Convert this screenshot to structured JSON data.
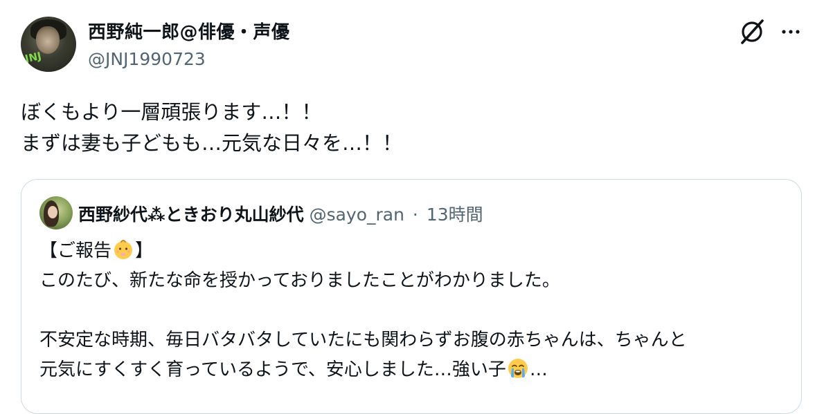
{
  "author": {
    "display_name": "西野純一郎@俳優・声優",
    "handle": "@JNJ1990723",
    "avatar_text": "JNJ"
  },
  "tweet": {
    "lines": [
      "ぼくもより一層頑張ります…！！",
      "まずは妻も子どもも…元気な日々を…！！"
    ]
  },
  "quote": {
    "author_name": "西野紗代⁂ときおり丸山紗代",
    "author_handle": "@sayo_ran",
    "separator": "·",
    "time": "13時間",
    "line1_prefix": "【ご報告",
    "line1_suffix": "】",
    "line2": "このたび、新たな命を授かっておりましたことがわかりました。",
    "line4": "不安定な時期、毎日バタバタしていたにも関わらずお腹の赤ちゃんは、ちゃんと",
    "line5_prefix": "元気にすくすく育っているようで、安心しました…強い子",
    "line5_suffix": "…"
  },
  "icons": {
    "grok": "grok-icon",
    "more": "more-options-icon",
    "baby_emoji": "baby-emoji",
    "crying_emoji": "loudly-crying-face-emoji"
  },
  "colors": {
    "text": "#0f1419",
    "secondary_text": "#536471",
    "border": "#cfd9de",
    "emoji_yellow": "#ffcc4d",
    "tears_blue": "#5dadec"
  }
}
